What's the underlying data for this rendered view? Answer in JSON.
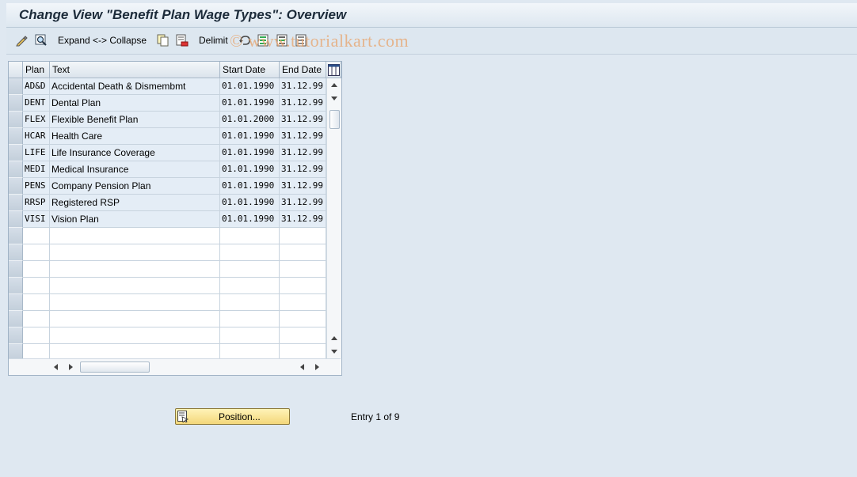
{
  "window": {
    "title": "Change View \"Benefit Plan Wage Types\": Overview"
  },
  "toolbar": {
    "expand_collapse_label": "Expand <-> Collapse",
    "delimit_label": "Delimit",
    "icons": [
      "display-change-icon",
      "details-icon",
      "copy-icon",
      "delete-icon",
      "undo-icon",
      "select-all-icon",
      "select-block-icon",
      "deselect-all-icon"
    ]
  },
  "watermark": "© www.tutorialkart.com",
  "table": {
    "columns": [
      "Plan",
      "Text",
      "Start Date",
      "End Date"
    ],
    "rows": [
      {
        "plan": "AD&D",
        "text": "Accidental Death & Dismembmt",
        "start": "01.01.1990",
        "end": "31.12.99"
      },
      {
        "plan": "DENT",
        "text": "Dental Plan",
        "start": "01.01.1990",
        "end": "31.12.99"
      },
      {
        "plan": "FLEX",
        "text": "Flexible Benefit Plan",
        "start": "01.01.2000",
        "end": "31.12.99"
      },
      {
        "plan": "HCAR",
        "text": "Health Care",
        "start": "01.01.1990",
        "end": "31.12.99"
      },
      {
        "plan": "LIFE",
        "text": "Life Insurance Coverage",
        "start": "01.01.1990",
        "end": "31.12.99"
      },
      {
        "plan": "MEDI",
        "text": "Medical Insurance",
        "start": "01.01.1990",
        "end": "31.12.99"
      },
      {
        "plan": "PENS",
        "text": "Company Pension Plan",
        "start": "01.01.1990",
        "end": "31.12.99"
      },
      {
        "plan": "RRSP",
        "text": "Registered RSP",
        "start": "01.01.1990",
        "end": "31.12.99"
      },
      {
        "plan": "VISI",
        "text": "Vision Plan",
        "start": "01.01.1990",
        "end": "31.12.99"
      }
    ],
    "empty_row_count": 8
  },
  "footer": {
    "position_button_label": "Position...",
    "entry_info": "Entry 1 of 9"
  },
  "colors": {
    "filled_row": "#e4edf6",
    "button_bg": "#f3d77a",
    "background": "#dfe8f1"
  }
}
